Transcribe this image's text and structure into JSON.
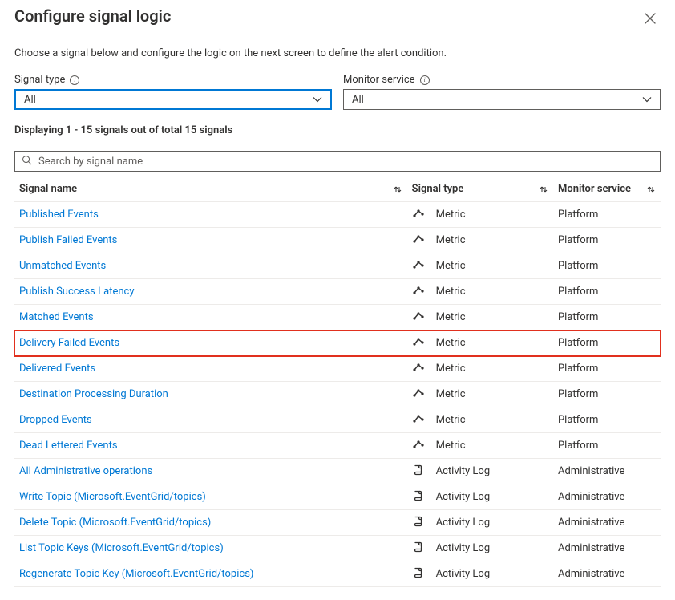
{
  "header": {
    "title": "Configure signal logic"
  },
  "intro": "Choose a signal below and configure the logic on the next screen to define the alert condition.",
  "filters": {
    "signal_type": {
      "label": "Signal type",
      "value": "All"
    },
    "monitor_service": {
      "label": "Monitor service",
      "value": "All"
    }
  },
  "counts": {
    "text": "Displaying 1 - 15 signals out of total 15 signals"
  },
  "search": {
    "placeholder": "Search by signal name",
    "value": ""
  },
  "table": {
    "columns": {
      "name": "Signal name",
      "type": "Signal type",
      "service": "Monitor service"
    },
    "highlighted_index": 5,
    "rows": [
      {
        "name": "Published Events",
        "type_icon": "metric",
        "type": "Metric",
        "service": "Platform"
      },
      {
        "name": "Publish Failed Events",
        "type_icon": "metric",
        "type": "Metric",
        "service": "Platform"
      },
      {
        "name": "Unmatched Events",
        "type_icon": "metric",
        "type": "Metric",
        "service": "Platform"
      },
      {
        "name": "Publish Success Latency",
        "type_icon": "metric",
        "type": "Metric",
        "service": "Platform"
      },
      {
        "name": "Matched Events",
        "type_icon": "metric",
        "type": "Metric",
        "service": "Platform"
      },
      {
        "name": "Delivery Failed Events",
        "type_icon": "metric",
        "type": "Metric",
        "service": "Platform"
      },
      {
        "name": "Delivered Events",
        "type_icon": "metric",
        "type": "Metric",
        "service": "Platform"
      },
      {
        "name": "Destination Processing Duration",
        "type_icon": "metric",
        "type": "Metric",
        "service": "Platform"
      },
      {
        "name": "Dropped Events",
        "type_icon": "metric",
        "type": "Metric",
        "service": "Platform"
      },
      {
        "name": "Dead Lettered Events",
        "type_icon": "metric",
        "type": "Metric",
        "service": "Platform"
      },
      {
        "name": "All Administrative operations",
        "type_icon": "activity",
        "type": "Activity Log",
        "service": "Administrative"
      },
      {
        "name": "Write Topic (Microsoft.EventGrid/topics)",
        "type_icon": "activity",
        "type": "Activity Log",
        "service": "Administrative"
      },
      {
        "name": "Delete Topic (Microsoft.EventGrid/topics)",
        "type_icon": "activity",
        "type": "Activity Log",
        "service": "Administrative"
      },
      {
        "name": "List Topic Keys (Microsoft.EventGrid/topics)",
        "type_icon": "activity",
        "type": "Activity Log",
        "service": "Administrative"
      },
      {
        "name": "Regenerate Topic Key (Microsoft.EventGrid/topics)",
        "type_icon": "activity",
        "type": "Activity Log",
        "service": "Administrative"
      }
    ]
  }
}
